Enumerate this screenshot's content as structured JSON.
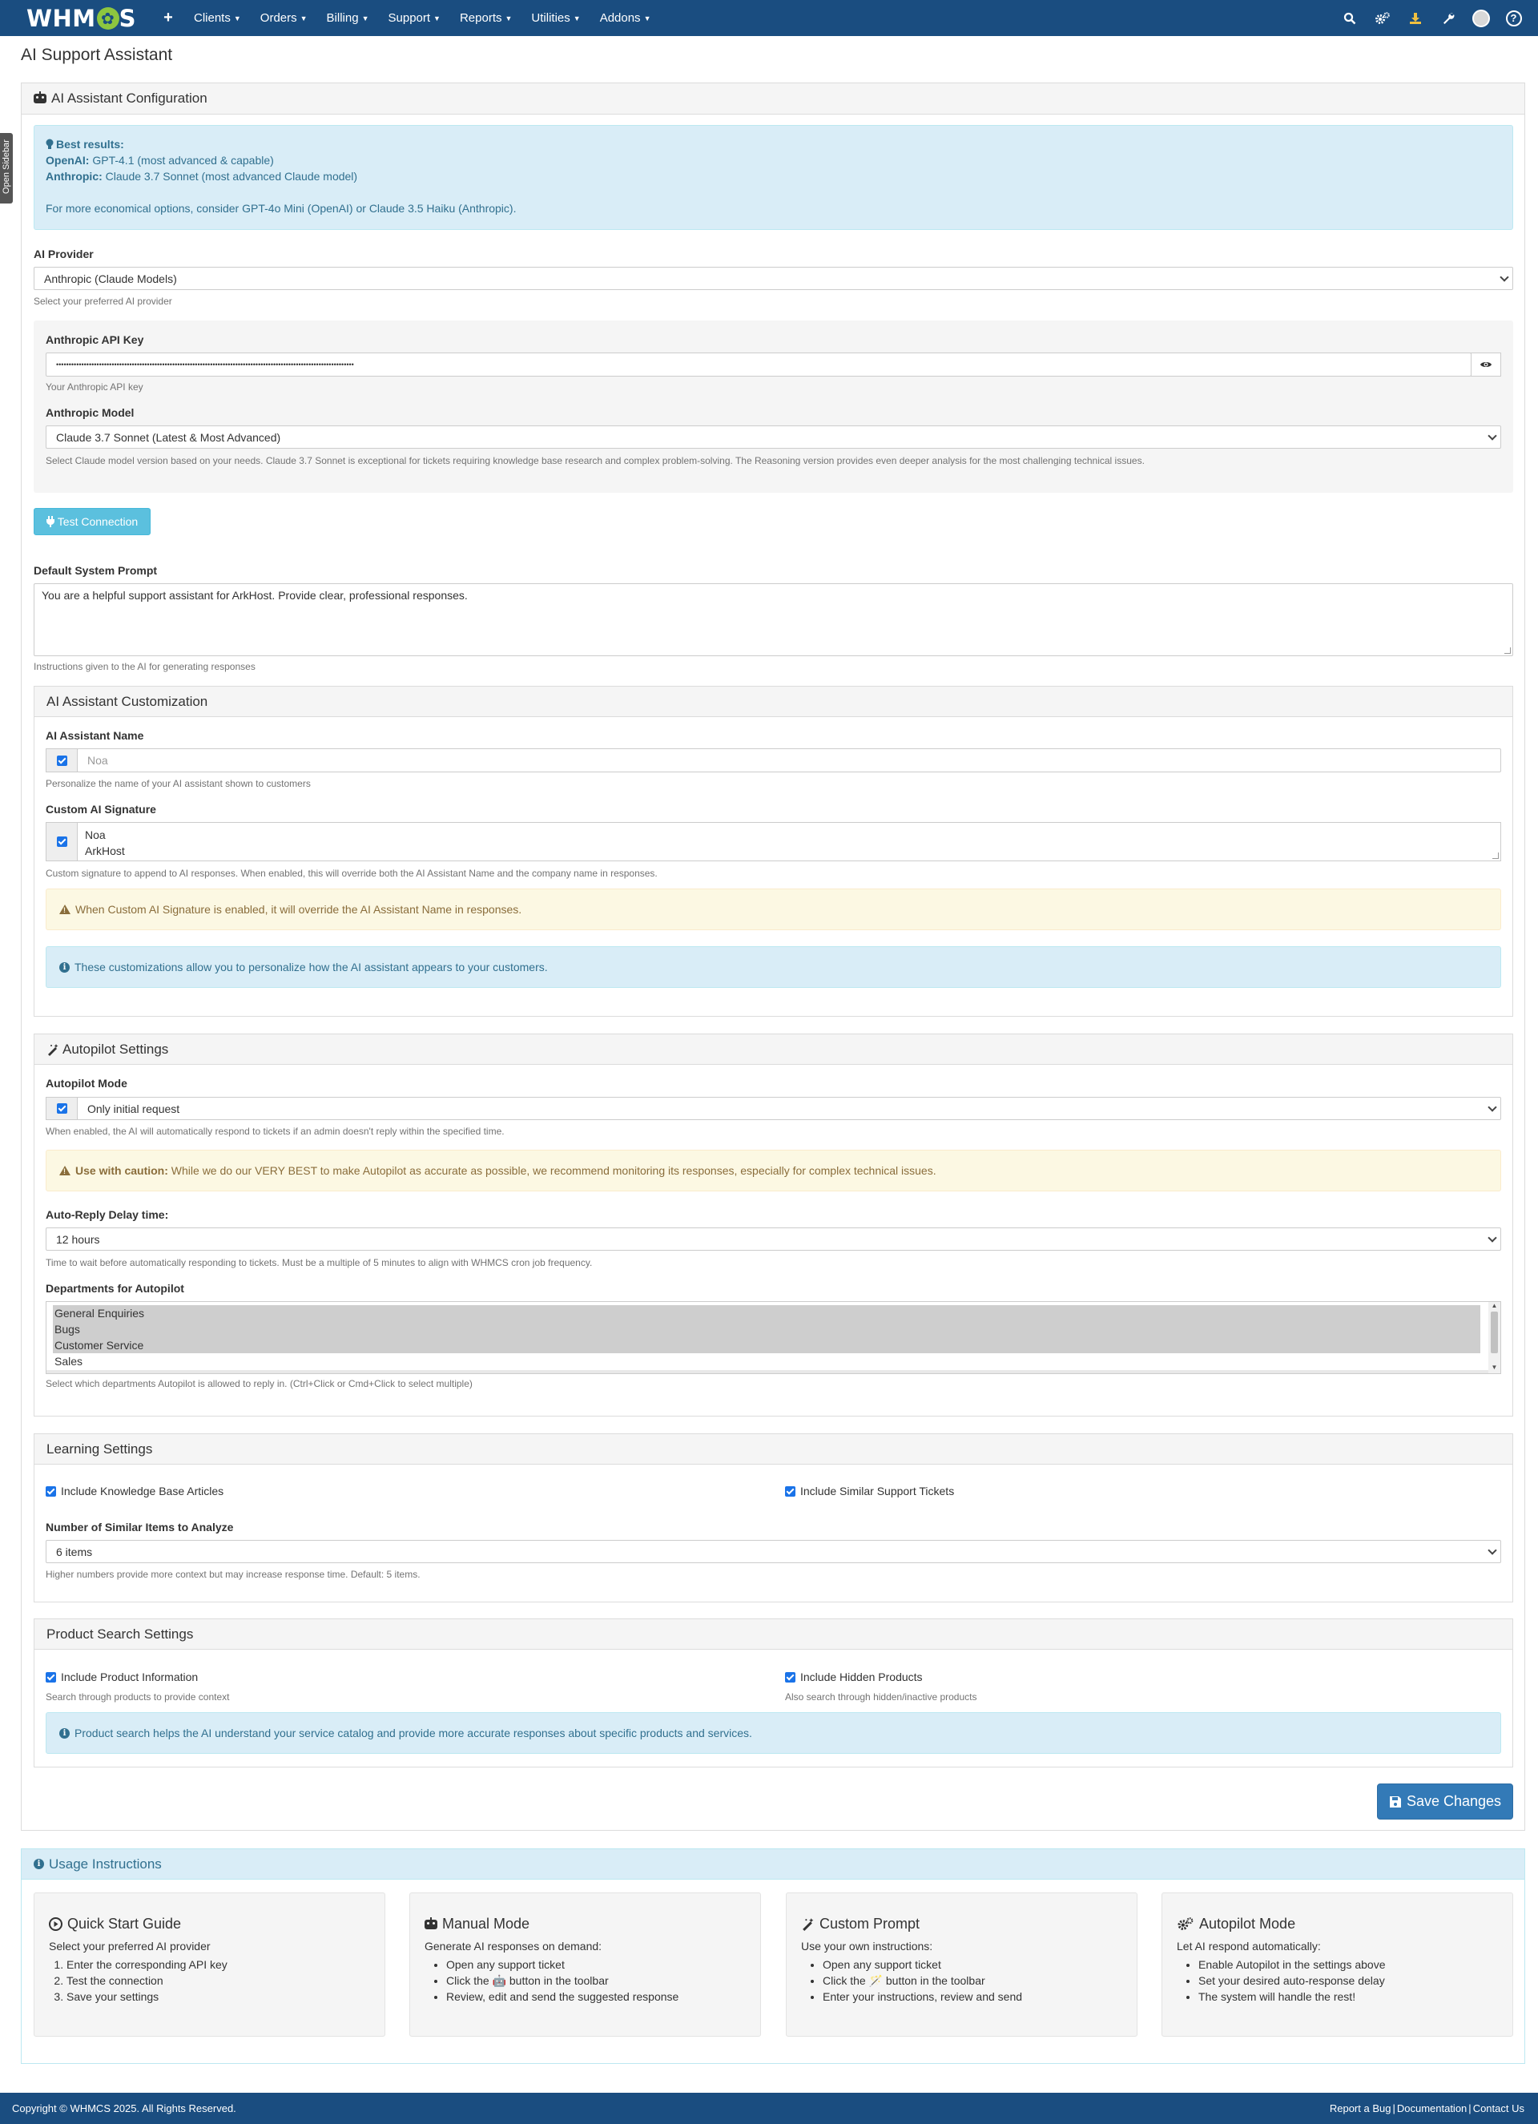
{
  "topbar": {
    "logo": "WHMCS",
    "nav": [
      "Clients",
      "Orders",
      "Billing",
      "Support",
      "Reports",
      "Utilities",
      "Addons"
    ],
    "icons": [
      "plus-icon",
      "search-icon",
      "cogs-icon",
      "download-icon",
      "wrench-icon",
      "avatar",
      "help-icon"
    ]
  },
  "sidebar_tab": "Open Sidebar",
  "page_title": "AI Support Assistant",
  "config": {
    "heading": "AI Assistant Configuration",
    "best_results_title": "Best results:",
    "openai_label": "OpenAI:",
    "openai_value": "GPT-4.1 (most advanced & capable)",
    "anthropic_label": "Anthropic:",
    "anthropic_value": "Claude 3.7 Sonnet (most advanced Claude model)",
    "economical": "For more economical options, consider GPT-4o Mini (OpenAI) or Claude 3.5 Haiku (Anthropic).",
    "provider_label": "AI Provider",
    "provider_value": "Anthropic (Claude Models)",
    "provider_help": "Select your preferred AI provider",
    "api_key_label": "Anthropic API Key",
    "api_key_value": "••••••••••••••••••••••••••••••••••••••••••••••••••••••••••••••••••••••••••••••••••••••••••••••••••••••••••••••••••••••",
    "api_key_help": "Your Anthropic API key",
    "model_label": "Anthropic Model",
    "model_value": "Claude 3.7 Sonnet (Latest & Most Advanced)",
    "model_help": "Select Claude model version based on your needs. Claude 3.7 Sonnet is exceptional for tickets requiring knowledge base research and complex problem-solving. The Reasoning version provides even deeper analysis for the most challenging technical issues.",
    "test_button": "Test Connection",
    "prompt_label": "Default System Prompt",
    "prompt_value": "You are a helpful support assistant for ArkHost. Provide clear, professional responses.",
    "prompt_help": "Instructions given to the AI for generating responses"
  },
  "customization": {
    "heading": "AI Assistant Customization",
    "name_label": "AI Assistant Name",
    "name_placeholder": "Noa",
    "name_help": "Personalize the name of your AI assistant shown to customers",
    "signature_label": "Custom AI Signature",
    "signature_line1": "Noa",
    "signature_line2": "ArkHost",
    "signature_help": "Custom signature to append to AI responses. When enabled, this will override both the AI Assistant Name and the company name in responses.",
    "warning": "When Custom AI Signature is enabled, it will override the AI Assistant Name in responses.",
    "info": "These customizations allow you to personalize how the AI assistant appears to your customers."
  },
  "autopilot": {
    "heading": "Autopilot Settings",
    "mode_label": "Autopilot Mode",
    "mode_value": "Only initial request",
    "mode_help": "When enabled, the AI will automatically respond to tickets if an admin doesn't reply within the specified time.",
    "caution_title": "Use with caution:",
    "caution_text": "While we do our VERY BEST to make Autopilot as accurate as possible, we recommend monitoring its responses, especially for complex technical issues.",
    "delay_label": "Auto-Reply Delay time:",
    "delay_value": "12 hours",
    "delay_help": "Time to wait before automatically responding to tickets. Must be a multiple of 5 minutes to align with WHMCS cron job frequency.",
    "departments_label": "Departments for Autopilot",
    "departments": [
      {
        "name": "General Enquiries",
        "selected": true
      },
      {
        "name": "Bugs",
        "selected": true
      },
      {
        "name": "Customer Service",
        "selected": true
      },
      {
        "name": "Sales",
        "selected": false
      }
    ],
    "departments_help": "Select which departments Autopilot is allowed to reply in. (Ctrl+Click or Cmd+Click to select multiple)"
  },
  "learning": {
    "heading": "Learning Settings",
    "kb_label": "Include Knowledge Base Articles",
    "similar_label": "Include Similar Support Tickets",
    "items_label": "Number of Similar Items to Analyze",
    "items_value": "6 items",
    "items_help": "Higher numbers provide more context but may increase response time. Default: 5 items."
  },
  "product": {
    "heading": "Product Search Settings",
    "info_label": "Include Product Information",
    "info_help": "Search through products to provide context",
    "hidden_label": "Include Hidden Products",
    "hidden_help": "Also search through hidden/inactive products",
    "note": "Product search helps the AI understand your service catalog and provide more accurate responses about specific products and services."
  },
  "save_button": "Save Changes",
  "usage": {
    "heading": "Usage Instructions",
    "cards": [
      {
        "icon": "play-circle-icon",
        "title": "Quick Start Guide",
        "intro": "Select your preferred AI provider",
        "ordered": true,
        "items": [
          "Enter the corresponding API key",
          "Test the connection",
          "Save your settings"
        ]
      },
      {
        "icon": "robot-icon",
        "title": "Manual Mode",
        "intro": "Generate AI responses on demand:",
        "ordered": false,
        "items": [
          "Open any support ticket",
          "Click the 🤖 button in the toolbar",
          "Review, edit and send the suggested response"
        ]
      },
      {
        "icon": "magic-icon",
        "title": "Custom Prompt",
        "intro": "Use your own instructions:",
        "ordered": false,
        "items": [
          "Open any support ticket",
          "Click the 🪄 button in the toolbar",
          "Enter your instructions, review and send"
        ]
      },
      {
        "icon": "cogs-icon",
        "title": "Autopilot Mode",
        "intro": "Let AI respond automatically:",
        "ordered": false,
        "items": [
          "Enable Autopilot in the settings above",
          "Set your desired auto-response delay",
          "The system will handle the rest!"
        ]
      }
    ]
  },
  "footer": {
    "copyright": "Copyright © WHMCS 2025. All Rights Reserved.",
    "links": [
      "Report a Bug",
      "Documentation",
      "Contact Us"
    ]
  },
  "colors": {
    "navbar": "#1a4d80",
    "info_bg": "#d9edf7",
    "warning_bg": "#fcf8e3",
    "primary": "#337ab7",
    "info_button": "#5bc0de"
  }
}
